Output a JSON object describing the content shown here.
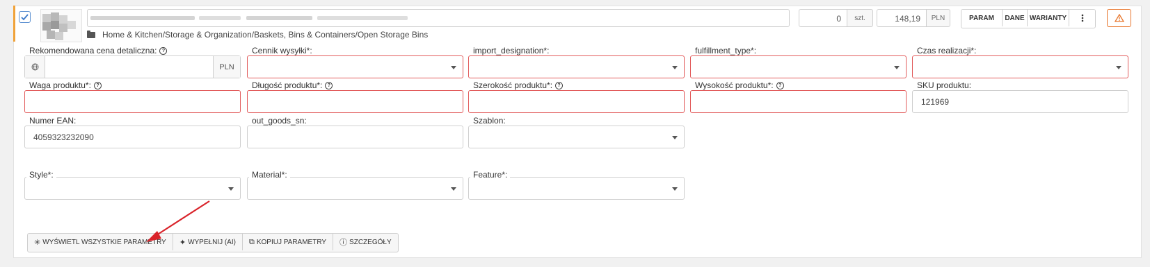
{
  "product": {
    "selected": true,
    "quantity": "0",
    "quantity_unit": "szt.",
    "price": "148,19",
    "price_currency": "PLN",
    "category_path": "Home & Kitchen/Storage & Organization/Baskets, Bins & Containers/Open Storage Bins"
  },
  "toolbar": {
    "param_label": "PARAM",
    "dane_label": "DANE",
    "warianty_label": "WARIANTY",
    "more_icon": "kebab-icon",
    "warning_icon": "warning-triangle-icon",
    "warning_color": "#e8762c"
  },
  "fields": {
    "rrp": {
      "label": "Rekomendowana cena detaliczna:",
      "value": "",
      "currency": "PLN"
    },
    "cennik": {
      "label": "Cennik wysyłki*:",
      "value": ""
    },
    "import_designation": {
      "label": "import_designation*:",
      "value": ""
    },
    "fulfillment_type": {
      "label": "fulfillment_type*:",
      "value": ""
    },
    "czas": {
      "label": "Czas realizacji*:",
      "value": ""
    },
    "waga": {
      "label": "Waga produktu*:",
      "value": ""
    },
    "dlugosc": {
      "label": "Długość produktu*:",
      "value": ""
    },
    "szerokosc": {
      "label": "Szerokość produktu*:",
      "value": ""
    },
    "wysokosc": {
      "label": "Wysokość produktu*:",
      "value": ""
    },
    "sku": {
      "label": "SKU produktu:",
      "value": "121969"
    },
    "ean": {
      "label": "Numer EAN:",
      "value": "4059323232090"
    },
    "out_goods_sn": {
      "label": "out_goods_sn:",
      "value": ""
    },
    "szablon": {
      "label": "Szablon:",
      "value": ""
    },
    "style": {
      "label": "Style*:",
      "value": ""
    },
    "material": {
      "label": "Material*:",
      "value": ""
    },
    "feature": {
      "label": "Feature*:",
      "value": ""
    }
  },
  "actions": {
    "show_all": "WYŚWIETL WSZYSTKIE PARAMETRY",
    "fill_ai": "WYPEŁNIJ (AI)",
    "copy": "KOPIUJ PARAMETRY",
    "details": "SZCZEGÓŁY"
  },
  "colors": {
    "required_border": "#e25b5b",
    "accent_bar": "#f0a23a",
    "annotation_arrow": "#d9232a"
  }
}
